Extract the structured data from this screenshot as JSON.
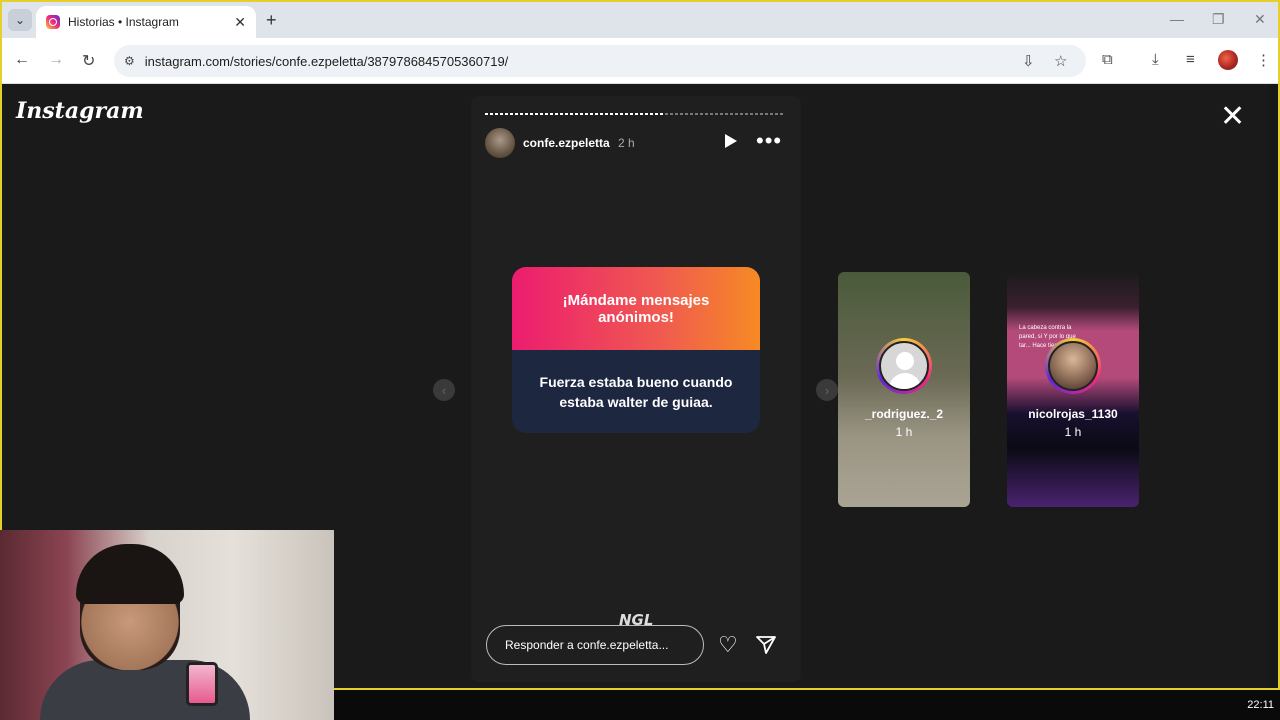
{
  "browser": {
    "tab_title": "Historias • Instagram",
    "url": "instagram.com/stories/confe.ezpeletta/3879786845705360719/"
  },
  "instagram": {
    "logo": "Instagram",
    "close_icon": "close-icon"
  },
  "story": {
    "username": "confe.ezpeletta",
    "time": "2 h",
    "progress": 0.6,
    "card_title": "¡Mándame mensajes anónimos!",
    "card_message": "Fuerza estaba bueno cuando estaba walter de guiaa.",
    "watermark": "NGL",
    "reply_placeholder": "Responder a confe.ezpeletta..."
  },
  "previews": [
    {
      "username": "_rodriguez._2",
      "time": "1 h"
    },
    {
      "username": "nicolrojas_1130",
      "time": "1 h",
      "overlay_text": "La cabeza contra la pared, si Y por lo que tar... Hace tiempo"
    }
  ],
  "system": {
    "clock": "22:11"
  },
  "colors": {
    "ngl_gradient_start": "#ec1c6f",
    "ngl_gradient_end": "#f68a24",
    "ngl_bottom": "#1d2740",
    "accent_border": "#e6cf2a"
  }
}
